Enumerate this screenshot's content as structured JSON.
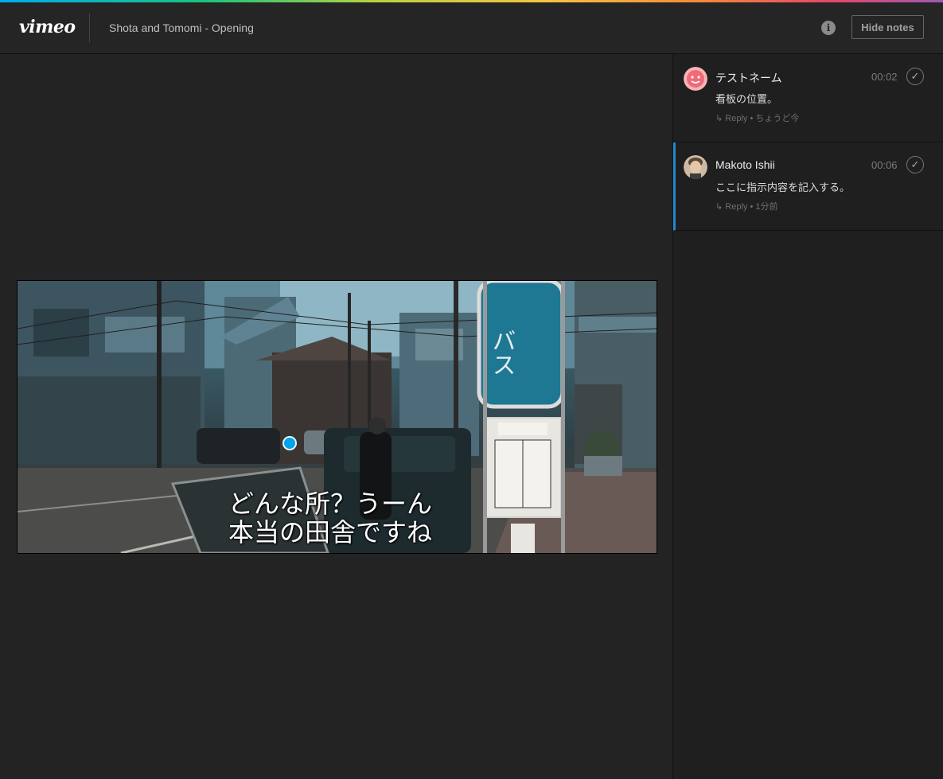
{
  "colors": {
    "accent": "#00a4e8",
    "active_note_border": "#1f8ad0"
  },
  "header": {
    "logo": "vimeo",
    "title": "Shota and Tomomi - Opening",
    "info_icon": "info-icon",
    "hide_notes_label": "Hide notes"
  },
  "video": {
    "subtitle_line1": "どんな所？うーん",
    "subtitle_line2": "本当の田舎ですね"
  },
  "notes": [
    {
      "author": "テストネーム",
      "timestamp": "00:02",
      "body": "看板の位置。",
      "reply_label": "↳ Reply",
      "separator": "•",
      "time_ago": "ちょうど今",
      "avatar_icon": "smiley-avatar"
    },
    {
      "author": "Makoto Ishii",
      "timestamp": "00:06",
      "body": "ここに指示内容を記入する。",
      "reply_label": "↳ Reply",
      "separator": "•",
      "time_ago": "1分前",
      "avatar_icon": "user-photo-avatar",
      "active": true
    }
  ]
}
